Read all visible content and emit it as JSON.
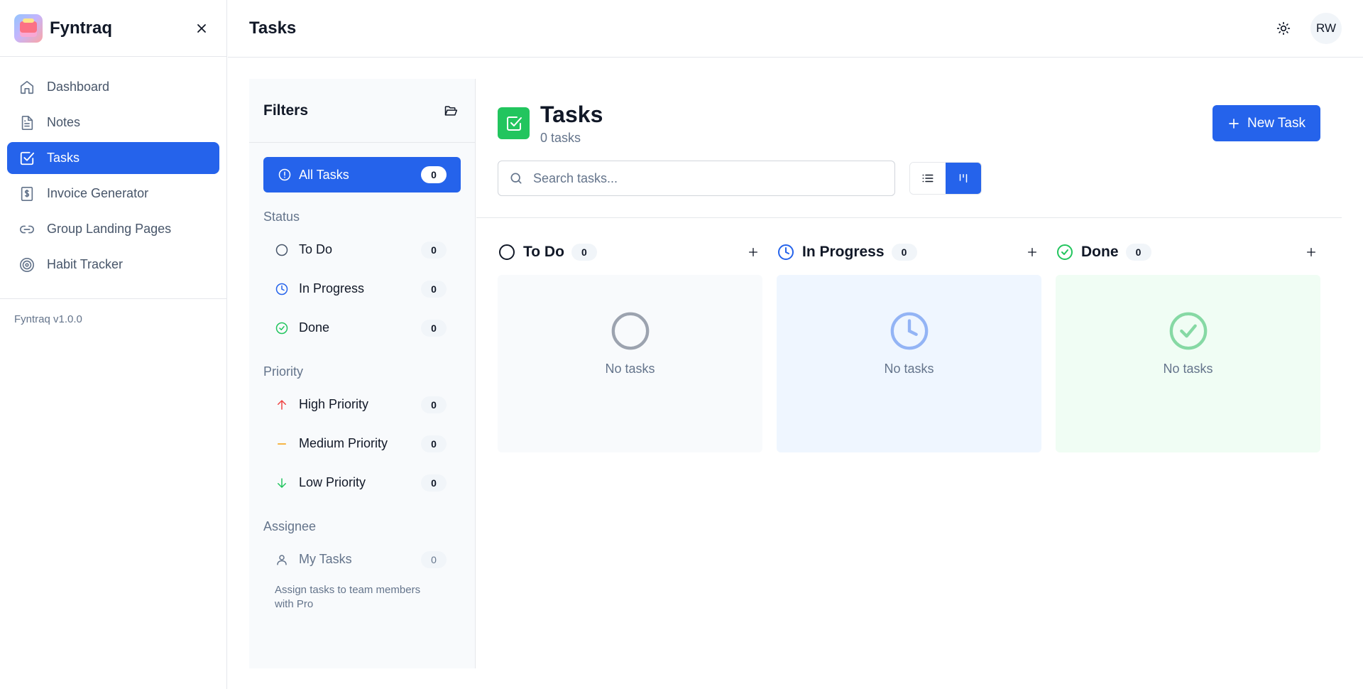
{
  "app": {
    "name": "Fyntraq",
    "version": "Fyntraq v1.0.0"
  },
  "sidebar": {
    "items": [
      {
        "label": "Dashboard",
        "icon": "home-icon"
      },
      {
        "label": "Notes",
        "icon": "document-icon"
      },
      {
        "label": "Tasks",
        "icon": "checkbox-icon",
        "active": true
      },
      {
        "label": "Invoice Generator",
        "icon": "invoice-icon"
      },
      {
        "label": "Group Landing Pages",
        "icon": "link-icon"
      },
      {
        "label": "Habit Tracker",
        "icon": "target-icon"
      }
    ]
  },
  "header": {
    "title": "Tasks",
    "avatar": "RW"
  },
  "filters": {
    "title": "Filters",
    "all_tasks": {
      "label": "All Tasks",
      "count": "0"
    },
    "status_label": "Status",
    "status": [
      {
        "label": "To Do",
        "count": "0",
        "icon": "circle-icon"
      },
      {
        "label": "In Progress",
        "count": "0",
        "icon": "clock-icon"
      },
      {
        "label": "Done",
        "count": "0",
        "icon": "check-circle-icon"
      }
    ],
    "priority_label": "Priority",
    "priority": [
      {
        "label": "High Priority",
        "count": "0",
        "icon": "arrow-up-icon",
        "color": "#ef4444"
      },
      {
        "label": "Medium Priority",
        "count": "0",
        "icon": "minus-icon",
        "color": "#f59e0b"
      },
      {
        "label": "Low Priority",
        "count": "0",
        "icon": "arrow-down-icon",
        "color": "#22c55e"
      }
    ],
    "assignee_label": "Assignee",
    "assignee": [
      {
        "label": "My Tasks",
        "count": "0",
        "icon": "user-icon"
      }
    ],
    "pro_note": "Assign tasks to team members with Pro"
  },
  "main": {
    "title": "Tasks",
    "subtitle": "0 tasks",
    "new_task_label": "New Task",
    "search_placeholder": "Search tasks...",
    "columns": [
      {
        "title": "To Do",
        "count": "0",
        "empty": "No tasks",
        "color": "#94a3b8"
      },
      {
        "title": "In Progress",
        "count": "0",
        "empty": "No tasks",
        "color": "#2563eb"
      },
      {
        "title": "Done",
        "count": "0",
        "empty": "No tasks",
        "color": "#22c55e"
      }
    ]
  },
  "colors": {
    "accent": "#2563eb",
    "success": "#22c55e"
  }
}
